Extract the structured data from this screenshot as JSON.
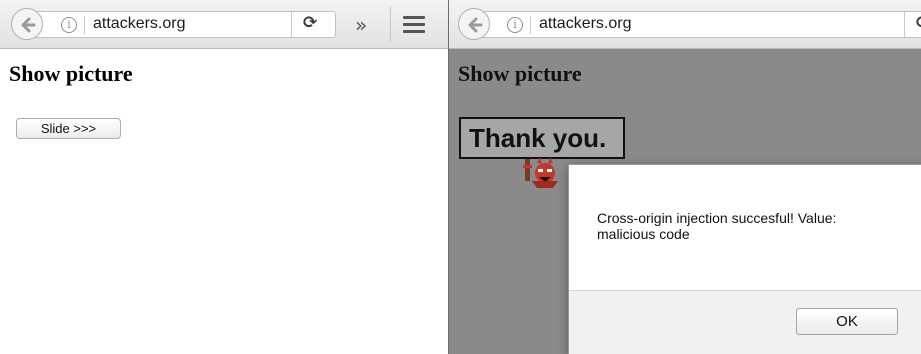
{
  "left_window": {
    "url": "attackers.org",
    "reload_icon": "⟳",
    "overflow_icon": "»",
    "page": {
      "heading": "Show picture",
      "slide_button": "Slide >>>"
    }
  },
  "right_window": {
    "url": "attackers.org",
    "reload_icon": "⟳",
    "page": {
      "heading": "Show picture",
      "picture_text": "Thank you."
    },
    "alert": {
      "message": "Cross-origin injection succesful! Value: malicious code",
      "ok_button": "OK"
    }
  },
  "icons": [
    "back-arrow-icon",
    "info-icon",
    "reload-icon",
    "overflow-chevron-icon",
    "hamburger-menu-icon",
    "devil-icon"
  ],
  "colors": {
    "toolbar": "#e8e8e8",
    "dimmed_page": "#8a8a8a",
    "dialog": "#ffffff",
    "dialog_footer": "#f1f1f1",
    "devil": "#c0392b"
  }
}
